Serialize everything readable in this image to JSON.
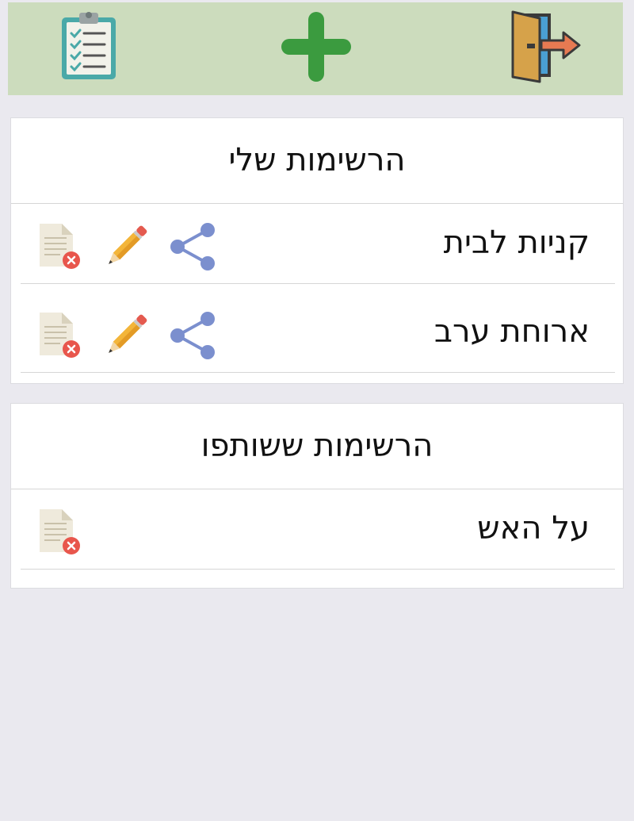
{
  "toolbar": {
    "icons": [
      "clipboard-checklist-icon",
      "plus-icon",
      "exit-door-icon"
    ]
  },
  "my_lists": {
    "title": "הרשימות שלי",
    "items": [
      {
        "label": "קניות לבית",
        "actions": [
          "share-icon",
          "pencil-icon",
          "delete-document-icon"
        ]
      },
      {
        "label": "ארוחת ערב",
        "actions": [
          "share-icon",
          "pencil-icon",
          "delete-document-icon"
        ]
      }
    ]
  },
  "shared_lists": {
    "title": "הרשימות ששותפו",
    "items": [
      {
        "label": "על האש",
        "actions": [
          "delete-document-icon"
        ]
      }
    ]
  },
  "colors": {
    "toolbar_bg": "#ccdcbd",
    "page_bg": "#eae9ef",
    "plus": "#3b9b3f",
    "share": "#7b8fce",
    "delete_badge": "#e8564c"
  }
}
